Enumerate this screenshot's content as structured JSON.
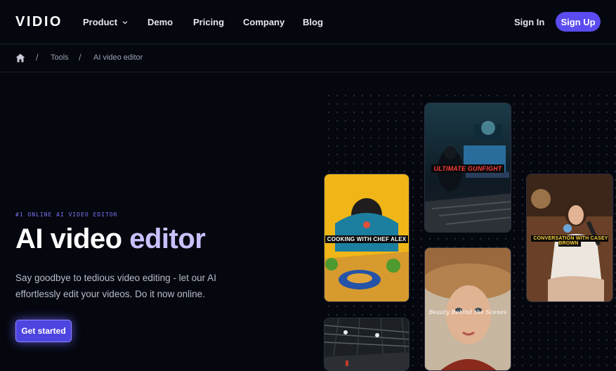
{
  "header": {
    "logo": "VIDIO",
    "nav": [
      {
        "label": "Product"
      },
      {
        "label": "Demo"
      },
      {
        "label": "Pricing"
      },
      {
        "label": "Company"
      },
      {
        "label": "Blog"
      }
    ],
    "signin_label": "Sign In",
    "signup_label": "Sign Up"
  },
  "breadcrumb": {
    "items": [
      "Tools",
      "AI video editor"
    ]
  },
  "hero": {
    "eyebrow": "#1 ONLINE AI VIDEO EDITOR",
    "title_main": "AI video ",
    "title_accent": "editor",
    "description": "Say goodbye to tedious video editing - let our AI effortlessly edit your videos. Do it now online.",
    "cta_label": "Get started"
  },
  "media_cards": [
    {
      "caption": "ULTIMATE GUNFIGHT"
    },
    {
      "caption": "COOKING WITH CHEF ALEX"
    },
    {
      "caption": "CONVERSATION WITH CASEY BROWN"
    },
    {
      "caption": "Beauty Behind the Scenes"
    },
    {
      "caption": ""
    }
  ],
  "colors": {
    "background": "#05070f",
    "accent": "#5a4cf0",
    "accent_text": "#c7c2ff"
  }
}
